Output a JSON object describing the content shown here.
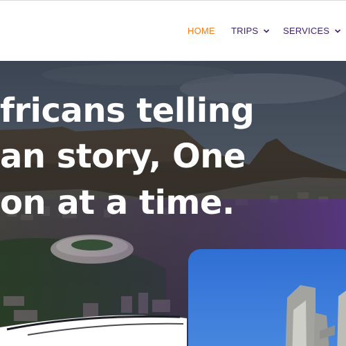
{
  "nav": {
    "items": [
      {
        "label": "HOME",
        "active": true
      },
      {
        "label": "TRIPS",
        "has_dropdown": true
      },
      {
        "label": "SERVICES",
        "has_dropdown": true
      }
    ],
    "active_color": "#f07d1a",
    "text_color": "#3b1f6e"
  },
  "hero": {
    "headline_lines": [
      "fricans telling",
      "an story, One",
      "on at a time."
    ],
    "text_color": "#ffffff"
  },
  "icons": {
    "dropdown": "chevron-down-icon"
  }
}
